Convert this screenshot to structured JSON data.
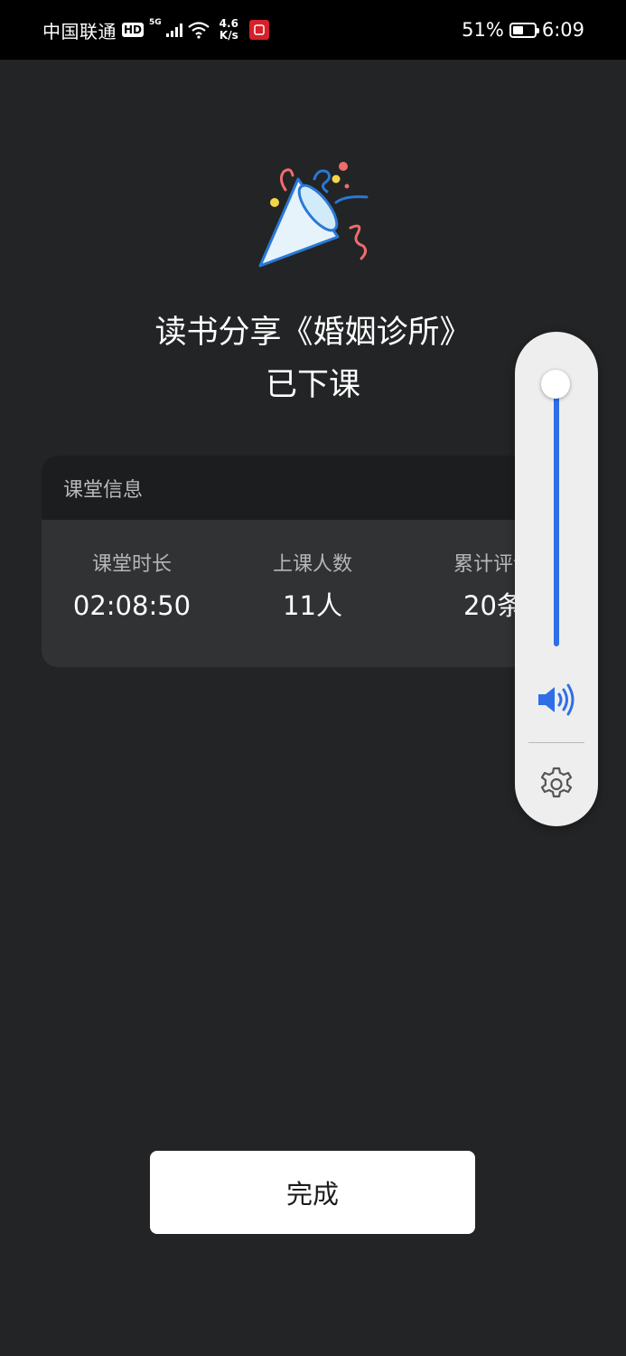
{
  "status_bar": {
    "carrier": "中国联通",
    "hd_badge": "HD",
    "network_type": "5G",
    "speed_value": "4.6",
    "speed_unit": "K/s",
    "app_icon": "app-notification-icon",
    "battery_percent": "51%",
    "battery_level": 0.51,
    "time": "6:09"
  },
  "main": {
    "icon": "party-popper-icon",
    "title_line1": "读书分享《婚姻诊所》",
    "title_line2": "已下课"
  },
  "class_info": {
    "header": "课堂信息",
    "stats": [
      {
        "label": "课堂时长",
        "value": "02:08:50"
      },
      {
        "label": "上课人数",
        "value": "11人"
      },
      {
        "label": "累计评论",
        "value": "20条"
      }
    ]
  },
  "volume_panel": {
    "level": 1.0,
    "speaker_icon": "speaker-volume-icon",
    "settings_icon": "gear-icon",
    "accent_color": "#2e6fe6"
  },
  "footer": {
    "done_label": "完成"
  },
  "colors": {
    "background": "#222425",
    "card": "#303233",
    "card_header": "#1b1d1f",
    "status_bar": "#000000"
  }
}
